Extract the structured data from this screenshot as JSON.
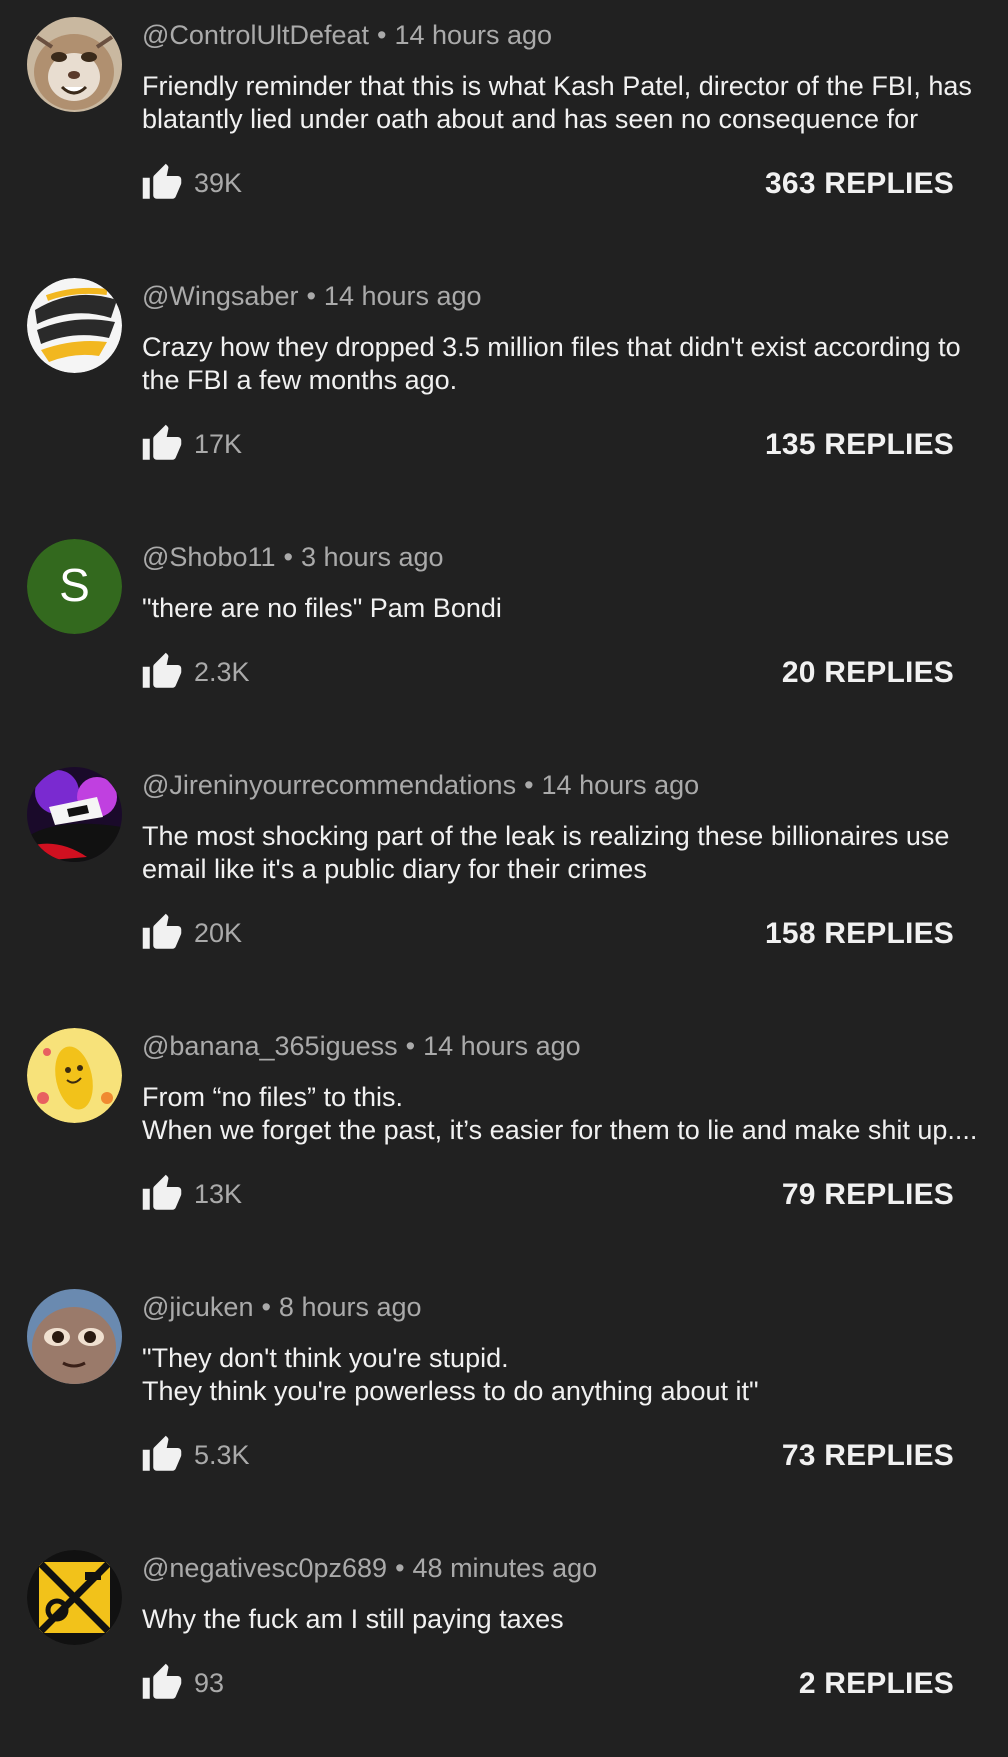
{
  "colors": {
    "background": "#212121",
    "text_primary": "#f1f1f1",
    "text_secondary": "#aaaaaa"
  },
  "comments": [
    {
      "author": "@ControlUltDefeat",
      "time": "14 hours ago",
      "lines": [
        "Friendly reminder that this is what Kash Patel, director of the FBI, has",
        "blatantly lied under oath about and has seen no consequence for"
      ],
      "likes": "39K",
      "replies": "363 REPLIES",
      "avatar_icon": "wildcat-avatar-icon"
    },
    {
      "author": "@Wingsaber",
      "time": "14 hours ago",
      "lines": [
        "Crazy how they dropped 3.5 million files that didn't exist according to",
        "the FBI a few months ago."
      ],
      "likes": "17K",
      "replies": "135 REPLIES",
      "avatar_icon": "wing-logo-avatar-icon"
    },
    {
      "author": "@Shobo11",
      "time": "3 hours ago",
      "lines": [
        "\"there are no files\" Pam Bondi"
      ],
      "likes": "2.3K",
      "replies": "20 REPLIES",
      "avatar_letter": "S",
      "avatar_color": "#33691e"
    },
    {
      "author": "@Jireninyourrecommendations",
      "time": "14 hours ago",
      "lines": [
        "The most shocking part of the leak is realizing these billionaires use",
        "email like it's a public diary for their crimes"
      ],
      "likes": "20K",
      "replies": "158 REPLIES",
      "avatar_icon": "masked-character-avatar-icon"
    },
    {
      "author": "@banana_365iguess",
      "time": "14 hours ago",
      "lines": [
        "From “no files” to this.",
        "When we forget the past, it’s easier for them to lie and make shit up...."
      ],
      "likes": "13K",
      "replies": "79 REPLIES",
      "avatar_icon": "banana-avatar-icon"
    },
    {
      "author": "@jicuken",
      "time": "8 hours ago",
      "lines": [
        "\"They don't think you're stupid.",
        "They think you're powerless to do anything about it\""
      ],
      "likes": "5.3K",
      "replies": "73 REPLIES",
      "avatar_icon": "face-closeup-avatar-icon"
    },
    {
      "author": "@negativesc0pz689",
      "time": "48 minutes ago",
      "lines": [
        "Why the fuck am I still paying taxes"
      ],
      "likes": "93",
      "replies": "2 REPLIES",
      "avatar_icon": "crest-avatar-icon"
    }
  ]
}
